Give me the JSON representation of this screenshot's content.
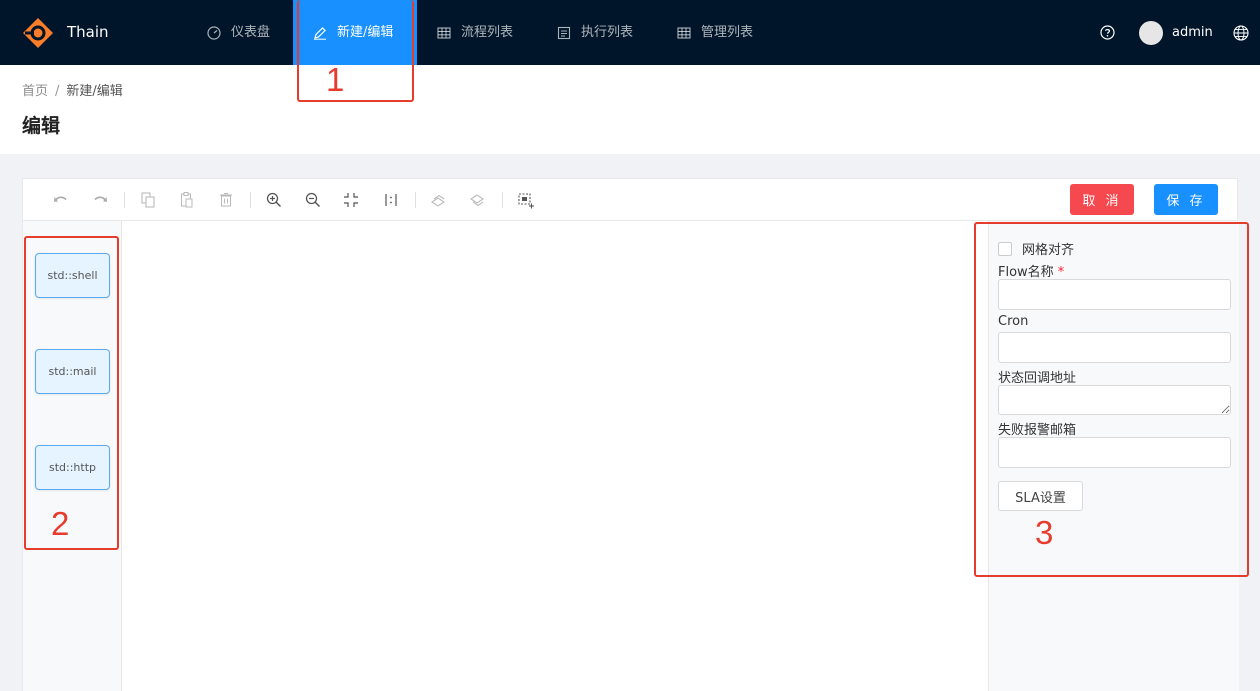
{
  "app": {
    "brand": "Thain"
  },
  "nav": {
    "items": [
      {
        "label": "仪表盘",
        "icon": "dashboard-icon"
      },
      {
        "label": "新建/编辑",
        "icon": "edit-icon",
        "active": true
      },
      {
        "label": "流程列表",
        "icon": "table-icon"
      },
      {
        "label": "执行列表",
        "icon": "list-icon"
      },
      {
        "label": "管理列表",
        "icon": "table-icon"
      }
    ],
    "user": "admin"
  },
  "breadcrumb": {
    "home": "首页",
    "sep": "/",
    "current": "新建/编辑"
  },
  "page": {
    "title": "编辑"
  },
  "toolbar": {
    "cancel_label": "取 消",
    "save_label": "保 存"
  },
  "itempanel": {
    "nodes": [
      "std::shell",
      "std::mail",
      "std::http"
    ]
  },
  "detail": {
    "grid_align": "网格对齐",
    "flow_name_label": "Flow名称",
    "required_mark": "*",
    "cron_label": "Cron",
    "callback_label": "状态回调地址",
    "alert_email_label": "失败报警邮箱",
    "sla_label": "SLA设置"
  },
  "annotations": [
    "1",
    "2",
    "3"
  ],
  "colors": {
    "nav_bg": "#001529",
    "accent": "#1890ff",
    "danger": "#f5484f",
    "annotation": "#e53c2d"
  }
}
